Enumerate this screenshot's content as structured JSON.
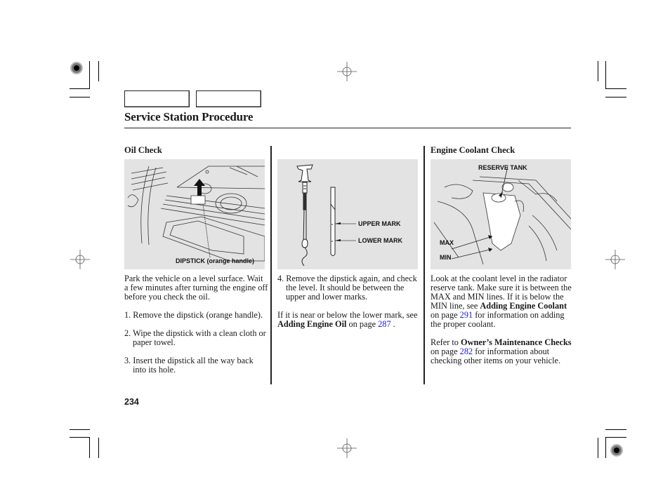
{
  "header": {
    "nav_tabs": [
      {
        "label": ""
      },
      {
        "label": ""
      }
    ],
    "page_title": "Service Station Procedure"
  },
  "columns": [
    {
      "heading": "Oil Check",
      "figure": {
        "callouts": [
          "DIPSTICK (orange handle)"
        ]
      },
      "intro": "Park the vehicle on a level surface. Wait a few minutes after turning the engine off before you check the oil.",
      "steps": [
        "1. Remove the dipstick (orange handle).",
        "2. Wipe the dipstick with a clean cloth or paper towel.",
        "3. Insert the dipstick all the way back into its hole."
      ]
    },
    {
      "heading": "",
      "figure": {
        "callouts": [
          "UPPER MARK",
          "LOWER MARK"
        ]
      },
      "steps": [
        "4. Remove the dipstick again, and check the level. It should be between the upper and lower marks."
      ],
      "note": {
        "prefix": "If it is near or below the lower mark, see ",
        "bold": "Adding Engine Oil",
        "mid": " on page ",
        "page_link": "287",
        "suffix": " ."
      }
    },
    {
      "heading": "Engine Coolant Check",
      "figure": {
        "callouts": [
          "RESERVE TANK",
          "MAX",
          "MIN"
        ]
      },
      "para1": {
        "prefix": "Look at the coolant level in the radiator reserve tank. Make sure it is between the MAX and MIN lines. If it is below the MIN line, see ",
        "bold": "Adding Engine Coolant",
        "mid": " on page ",
        "page_link": "291",
        "suffix": " for information on adding the proper coolant."
      },
      "para2": {
        "prefix": "Refer to ",
        "bold": "Owner’s Maintenance Checks",
        "mid": " on page ",
        "page_link": "282",
        "suffix": " for information about checking other items on your vehicle."
      }
    }
  ],
  "footer": {
    "page_number": "234"
  },
  "colors": {
    "link": "#1a1ad6",
    "figure_bg": "#e3e3e3",
    "text": "#1a1a1a"
  },
  "icons": {
    "registration_marks": "crosshair-circle-icon",
    "corner_targets": "radial-target-icon"
  }
}
